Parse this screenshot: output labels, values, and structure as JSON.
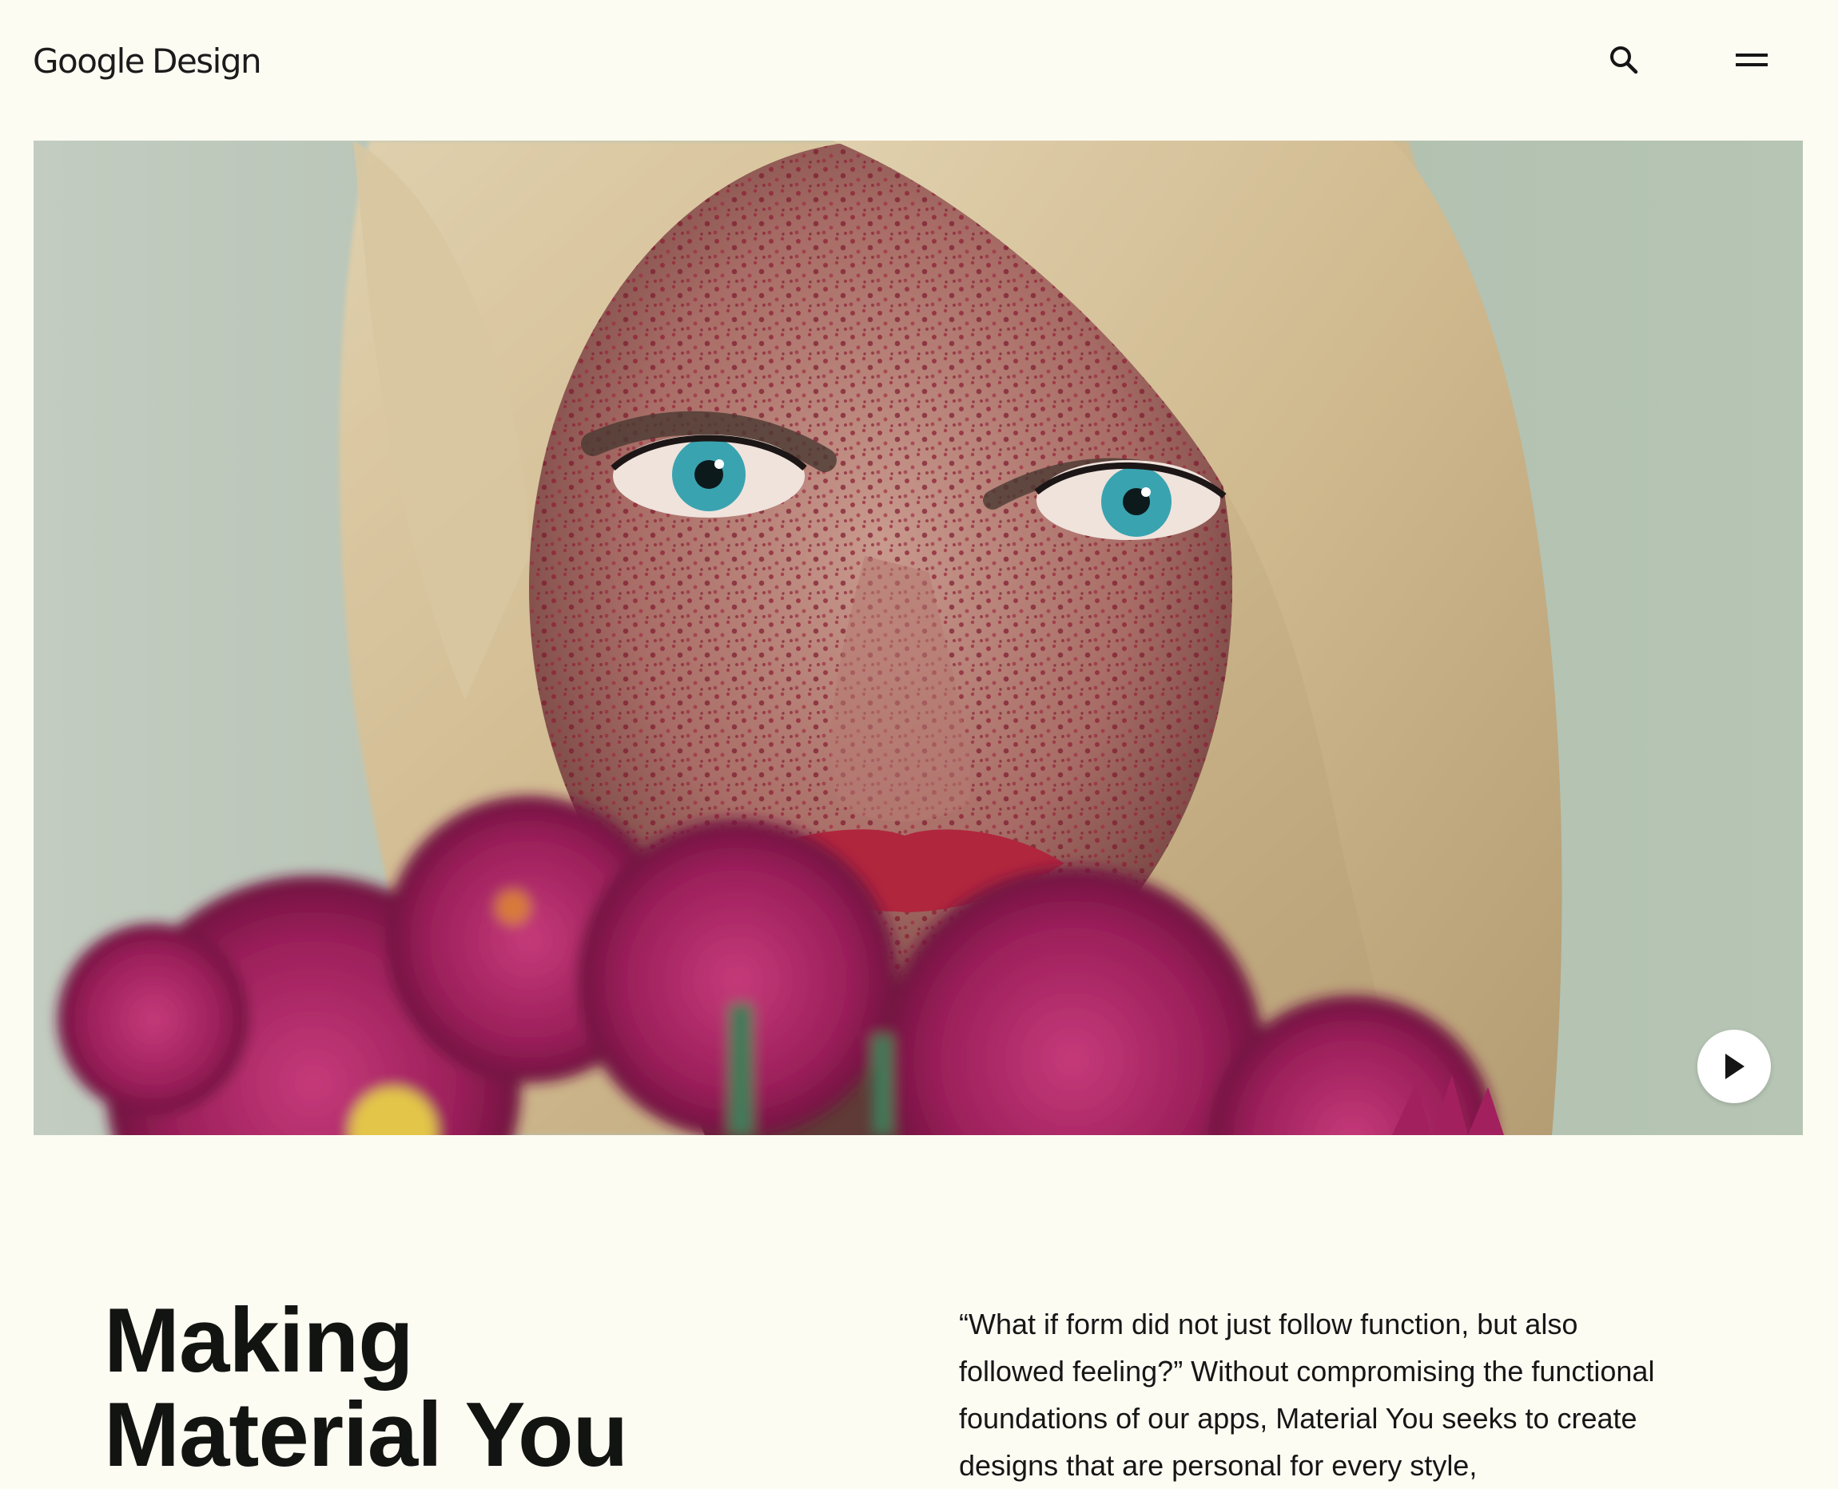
{
  "header": {
    "logo_google": "Google",
    "logo_design": "Design",
    "search_icon": "search-icon",
    "menu_icon": "menu-icon"
  },
  "hero": {
    "image_subject": "portrait-with-freckles-and-magenta-flowers",
    "play_icon": "play-icon",
    "colors": {
      "background": "#b9c7b6",
      "hair": "#d6c29a",
      "flowers": "#9b1f5a"
    }
  },
  "article": {
    "title_line1": "Making",
    "title_line2": "Material You",
    "intro": "“What if form did not just follow function, but also followed feeling?” Without compromising the functional foundations of our apps, Material You seeks to create designs that are personal for every style,"
  },
  "colors": {
    "page_background": "#fdfcf3",
    "text": "#151515"
  }
}
